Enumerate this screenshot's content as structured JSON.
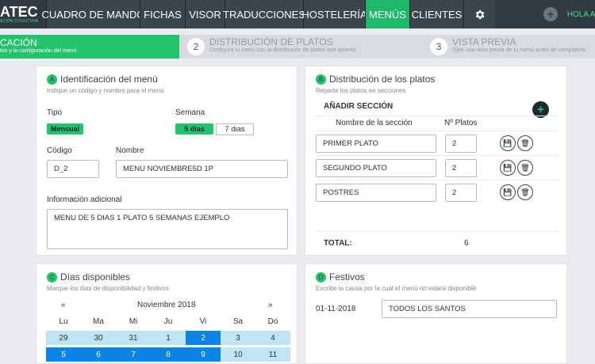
{
  "nav": {
    "brand_main": "ATEC",
    "brand_sub": "ACIÓN COLECTIVA",
    "items": [
      "CUADRO DE MANDO",
      "FICHAS",
      "VISOR",
      "TRADUCCIONES",
      "HOSTELERÍA",
      "MENÚS",
      "CLIENTES"
    ],
    "active": "MENÚS",
    "user": "HOLA AL"
  },
  "steps": [
    {
      "num": "",
      "title": "CACIÓN",
      "subtitle": "tos y la configuración del menú",
      "active": true
    },
    {
      "num": "2",
      "title": "DISTRIBUCIÓN DE PLATOS",
      "subtitle": "Configura tu menú con la distribución de platos que quieras",
      "active": false
    },
    {
      "num": "3",
      "title": "VISTA PREVIA",
      "subtitle": "Ojea una vista previa de tu menú antes de compartirlo",
      "active": false
    }
  ],
  "identificacion": {
    "letter": "A",
    "title": "Identificación del menú",
    "subtitle": "Indique un código y nombre para el menú",
    "tipo_label": "Tipo",
    "tipo_value": "Mensual",
    "semana_label": "Semana",
    "semana_options": [
      "5 dias",
      "7 dias"
    ],
    "semana_selected": "5 dias",
    "codigo_label": "Código",
    "codigo_value": "D_2",
    "nombre_label": "Nombre",
    "nombre_value": "MENU NOVIEMBRE5D 1P",
    "info_label": "Información adicional",
    "info_value": "MENU DE 5 DIAS 1 PLATO 5 SEMANAS EJEMPLO"
  },
  "distribucion": {
    "letter": "B",
    "title": "Distribución de los platos",
    "subtitle": "Reparte los platos en secciones",
    "add_label": "AÑADIR SECCIÓN",
    "col_nombre": "Nombre de la sección",
    "col_platos": "Nº Platos",
    "sections": [
      {
        "name": "PRIMER PLATO",
        "count": "2"
      },
      {
        "name": "SEGUNDO PLATO",
        "count": "2"
      },
      {
        "name": "POSTRES",
        "count": "2"
      }
    ],
    "total_label": "TOTAL:",
    "total_value": "6"
  },
  "dias": {
    "letter": "C",
    "title": "Días disponibles",
    "subtitle": "Marque los dias de disponibilidad y festivos",
    "prev": "«",
    "next": "»",
    "month": "Noviembre 2018",
    "weekdays": [
      "Lu",
      "Ma",
      "Mi",
      "Ju",
      "Vi",
      "Sa",
      "Do"
    ],
    "rows": [
      [
        "29",
        "30",
        "31",
        "1",
        "2",
        "3",
        "4"
      ],
      [
        "5",
        "6",
        "7",
        "8",
        "9",
        "10",
        "11"
      ]
    ]
  },
  "festivos": {
    "letter": "D",
    "title": "Festivos",
    "subtitle": "Escribe la causa por la cual el menú no estará disponible",
    "items": [
      {
        "date": "01-11-2018",
        "cause": "TODOS LOS SANTOS"
      }
    ]
  },
  "colors": {
    "nav_bg": "#2f3a43",
    "accent_green": "#23c36d",
    "calendar_selected": "#0a84e5",
    "calendar_available": "#bfe5f5"
  }
}
